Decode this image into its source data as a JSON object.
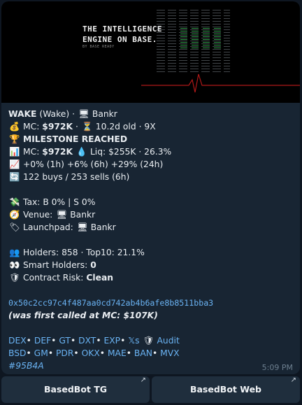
{
  "banner": {
    "title_line1": "THE INTELLIGENCE",
    "title_line2": "ENGINE ON BASE.",
    "tagline": "BY BASE READY"
  },
  "message": {
    "token_line": {
      "name": "WAKE",
      "ticker": "(Wake)",
      "sep": "·",
      "platform_icon": "computer-icon",
      "platform": "Bankr"
    },
    "mc_line": {
      "icon": "money-bag-icon",
      "label": "MC:",
      "value": "$972K",
      "sep": "·",
      "age_icon": "hourglass-icon",
      "age": "10.2d old",
      "multiple": "9X"
    },
    "milestone": {
      "icon": "trophy-icon",
      "text": "MILESTONE REACHED"
    },
    "stats_line": {
      "icon": "bar-chart-icon",
      "mc_label": "MC:",
      "mc_value": "$972K",
      "liq_icon": "droplet-icon",
      "liq_text": "Liq: $255K · 26.3%"
    },
    "change_line": {
      "icon": "chart-up-icon",
      "text": "+0% (1h) +6% (6h) +29% (24h)"
    },
    "trades_line": {
      "icon": "repeat-icon",
      "text": "122 buys / 253 sells (6h)"
    },
    "tax_line": {
      "icon": "money-wings-icon",
      "text": "Tax: B 0% | S 0%"
    },
    "venue_line": {
      "icon": "compass-icon",
      "label": "Venue:",
      "icon2": "computer-icon",
      "value": "Bankr"
    },
    "launchpad_line": {
      "icon": "label-tag-icon",
      "label": "Launchpad:",
      "icon2": "computer-icon",
      "value": "Bankr"
    },
    "holders_line": {
      "icon": "people-icon",
      "text": "Holders: 858 · Top10: 21.1%"
    },
    "smart_line": {
      "icon": "eyes-icon",
      "label": "Smart Holders:",
      "value": "0"
    },
    "risk_line": {
      "icon": "shield-icon",
      "label": "Contract Risk:",
      "value": "Clean"
    },
    "contract_address": "0x50c2cc97c4f487aa0cd742ab4b6afe8b8511bba3",
    "first_called": "(was first called at MC: $107K)",
    "links_row1": [
      "DEX",
      "DEF",
      "GT",
      "DXT",
      "EXP",
      "𝕏s"
    ],
    "audit_label": "Audit",
    "links_row2": [
      "BSD",
      "GM",
      "PDR",
      "OKX",
      "MAE",
      "BAN",
      "MVX"
    ],
    "hashtag": "#95B4A",
    "time": "5:09 PM"
  },
  "buttons": [
    {
      "label": "BasedBot TG"
    },
    {
      "label": "BasedBot Web"
    }
  ],
  "colors": {
    "background": "#0e1621",
    "bubble": "#182533",
    "link": "#6ab3f3",
    "button": "#1f2e3d"
  }
}
